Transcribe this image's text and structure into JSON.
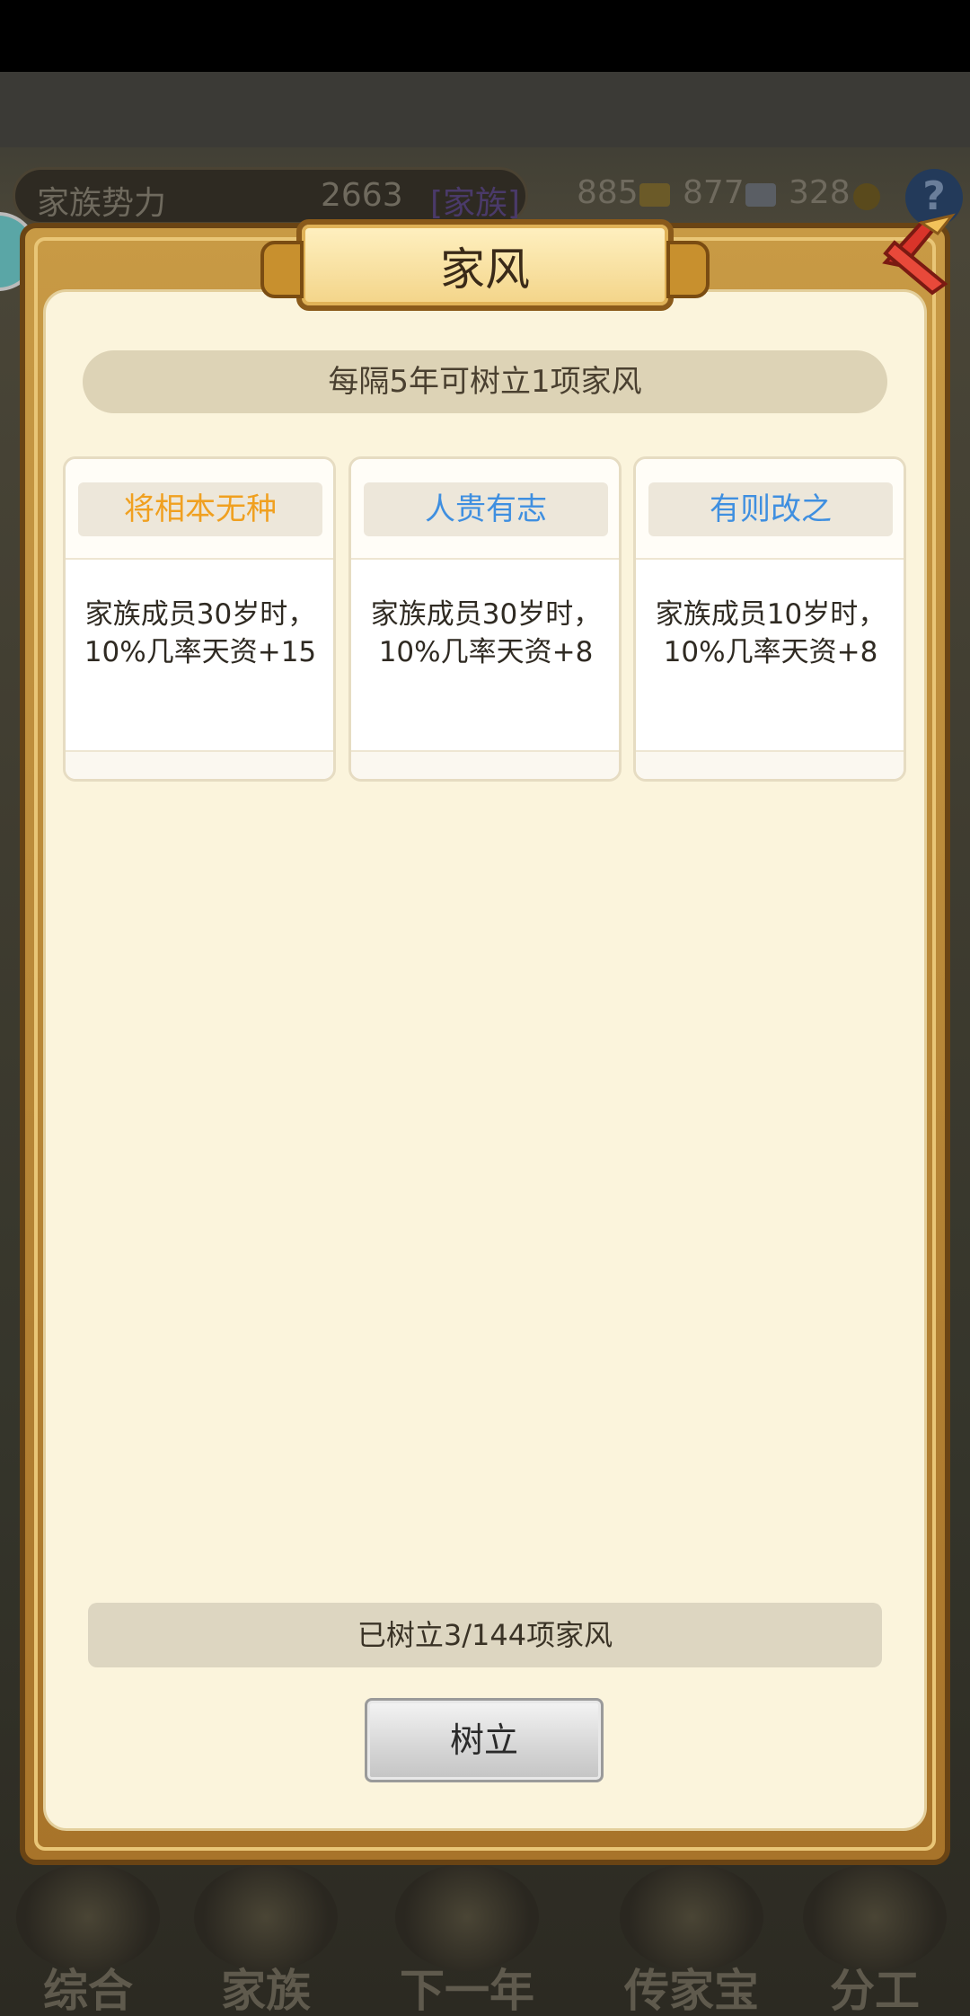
{
  "background": {
    "influence": {
      "label": "家族势力",
      "value": "2663",
      "tag": "[家族]"
    },
    "currencies": [
      {
        "value": "885",
        "icon": "gold-bar-icon",
        "color": "#c8a032"
      },
      {
        "value": "877",
        "icon": "silver-ingot-icon",
        "color": "#9aa0a8"
      },
      {
        "value": "328",
        "icon": "coin-icon",
        "color": "#b8902a"
      }
    ],
    "help": "?",
    "nav": [
      "综合",
      "家族",
      "下一年",
      "传家宝",
      "分工"
    ]
  },
  "modal": {
    "title": "家风",
    "info": "每隔5年可树立1项家风",
    "cards": [
      {
        "name": "将相本无种",
        "name_color": "#f0a020",
        "desc": "家族成员30岁时，10%几率天资+15"
      },
      {
        "name": "人贵有志",
        "name_color": "#3f8fe0",
        "desc": "家族成员30岁时，10%几率天资+8"
      },
      {
        "name": "有则改之",
        "name_color": "#3f8fe0",
        "desc": "家族成员10岁时，10%几率天资+8"
      }
    ],
    "progress_text": "已树立3/144项家风",
    "button": "树立"
  }
}
